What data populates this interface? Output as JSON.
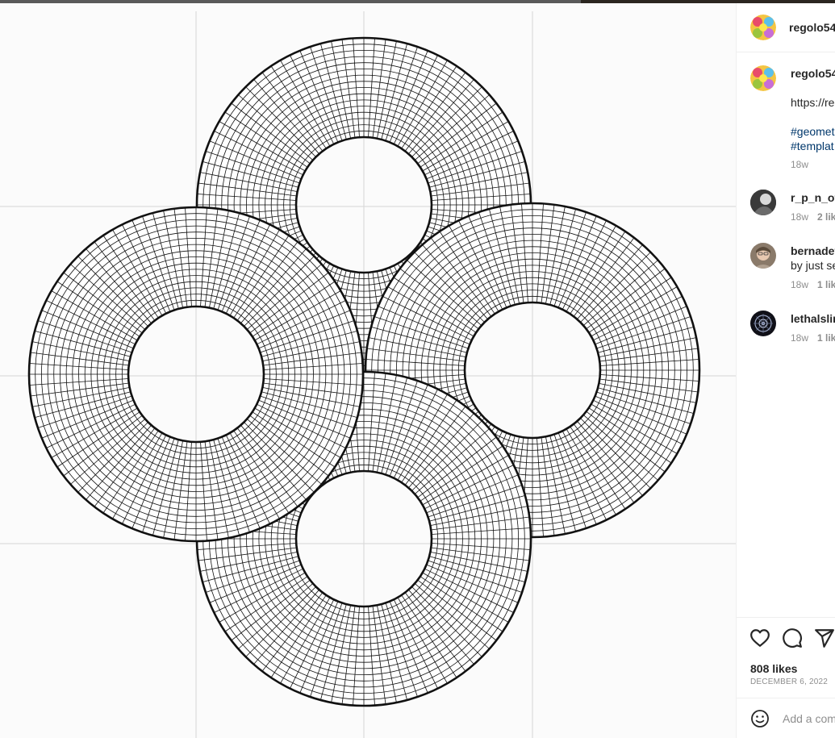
{
  "post": {
    "author": "regolo54",
    "caption_author": "regolo54",
    "caption_text": "https://re",
    "hashtags": [
      "#geomet",
      "#templat"
    ],
    "caption_age": "18w",
    "likes": "808 likes",
    "date": "DECEMBER 6, 2022",
    "add_comment_placeholder": "Add a com"
  },
  "comments": [
    {
      "user": "r_p_n_off",
      "text": "",
      "age": "18w",
      "likes": "2 lik"
    },
    {
      "user": "bernadet",
      "text": "by just se",
      "age": "18w",
      "likes": "1 lik"
    },
    {
      "user": "lethalslin",
      "text": "",
      "age": "18w",
      "likes": "1 lik"
    }
  ],
  "icons": {
    "like": "heart-icon",
    "comment": "comment-bubble-icon",
    "share": "paper-plane-icon",
    "emoji": "emoji-smile-icon"
  },
  "colors": {
    "text": "#262626",
    "secondary": "#8e8e8e",
    "hashtag": "#00376b",
    "ink": "#111111"
  }
}
